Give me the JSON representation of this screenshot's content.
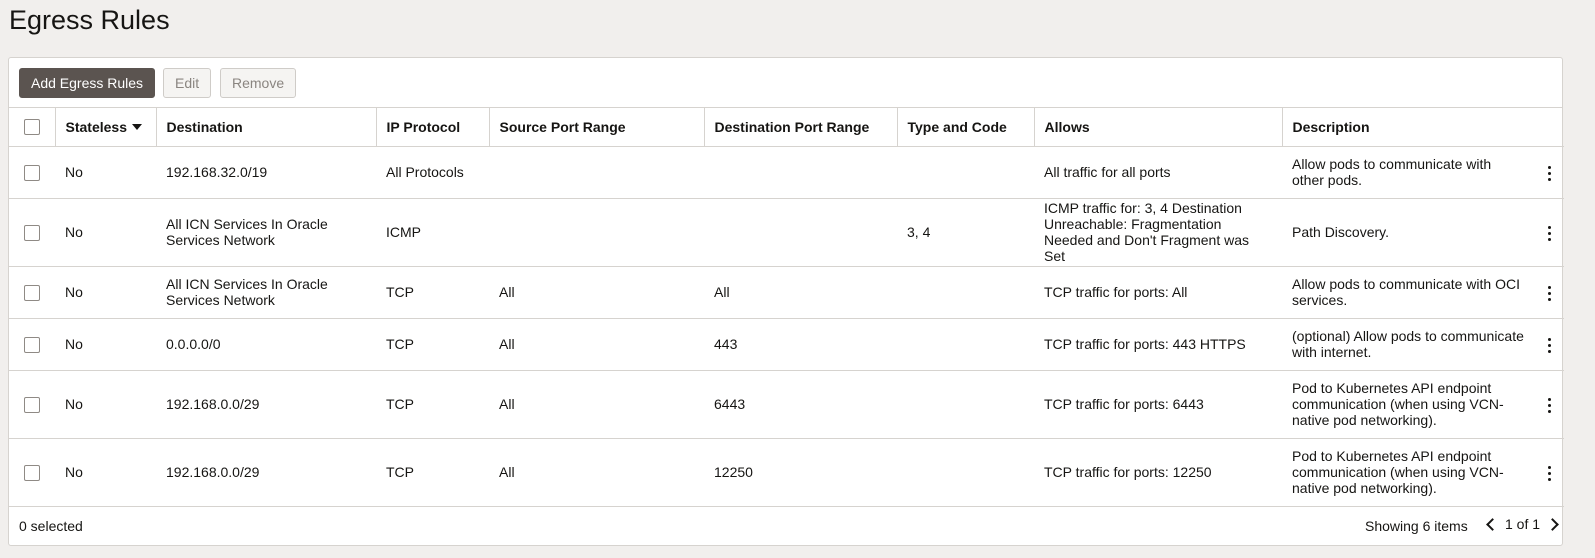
{
  "title": "Egress Rules",
  "toolbar": {
    "add_label": "Add Egress Rules",
    "edit_label": "Edit",
    "remove_label": "Remove"
  },
  "columns": {
    "stateless": "Stateless",
    "destination": "Destination",
    "ip_protocol": "IP Protocol",
    "source_port_range": "Source Port Range",
    "destination_port_range": "Destination Port Range",
    "type_and_code": "Type and Code",
    "allows": "Allows",
    "description": "Description"
  },
  "rows": [
    {
      "stateless": "No",
      "destination": "192.168.32.0/19",
      "ip_protocol": "All Protocols",
      "source_port_range": "",
      "destination_port_range": "",
      "type_and_code": "",
      "allows": "All traffic for all ports",
      "description": "Allow pods to communicate with other pods."
    },
    {
      "stateless": "No",
      "destination": "All ICN Services In Oracle Services Network",
      "ip_protocol": "ICMP",
      "source_port_range": "",
      "destination_port_range": "",
      "type_and_code": "3, 4",
      "allows": "ICMP traffic for: 3, 4 Destination Unreachable: Fragmentation Needed and Don't Fragment was Set",
      "description": "Path Discovery."
    },
    {
      "stateless": "No",
      "destination": "All ICN Services In Oracle Services Network",
      "ip_protocol": "TCP",
      "source_port_range": "All",
      "destination_port_range": "All",
      "type_and_code": "",
      "allows": "TCP traffic for ports: All",
      "description": "Allow pods to communicate with OCI services."
    },
    {
      "stateless": "No",
      "destination": "0.0.0.0/0",
      "ip_protocol": "TCP",
      "source_port_range": "All",
      "destination_port_range": "443",
      "type_and_code": "",
      "allows": "TCP traffic for ports: 443 HTTPS",
      "description": "(optional) Allow pods to communicate with internet."
    },
    {
      "stateless": "No",
      "destination": "192.168.0.0/29",
      "ip_protocol": "TCP",
      "source_port_range": "All",
      "destination_port_range": "6443",
      "type_and_code": "",
      "allows": "TCP traffic for ports: 6443",
      "description": "Pod to Kubernetes API endpoint communication (when using VCN-native pod networking)."
    },
    {
      "stateless": "No",
      "destination": "192.168.0.0/29",
      "ip_protocol": "TCP",
      "source_port_range": "All",
      "destination_port_range": "12250",
      "type_and_code": "",
      "allows": "TCP traffic for ports: 12250",
      "description": "Pod to Kubernetes API endpoint communication (when using VCN-native pod networking)."
    }
  ],
  "footer": {
    "selected": "0 selected",
    "showing": "Showing 6 items",
    "page": "1 of 1"
  },
  "icons": {
    "sort": "sort-desc-icon",
    "row_menu": "kebab-menu-icon",
    "prev": "chevron-left-icon",
    "next": "chevron-right-icon"
  },
  "colors": {
    "primary_button": "#5b5450",
    "background": "#f1efed",
    "border": "#d6d3cf"
  }
}
